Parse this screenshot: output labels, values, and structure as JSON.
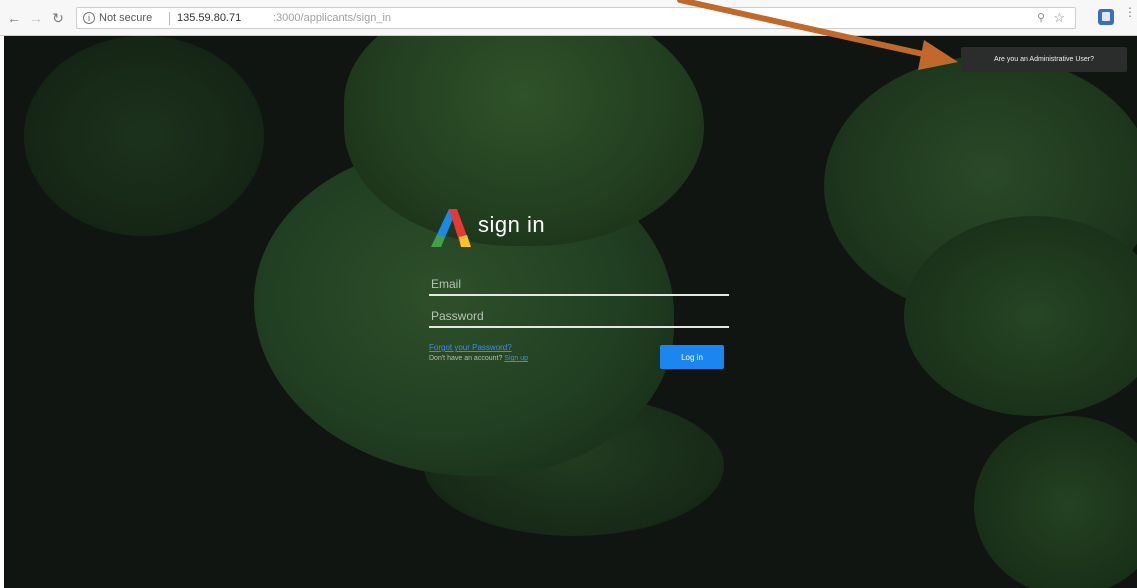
{
  "browser": {
    "back_icon": "back-arrow-icon",
    "forward_icon": "forward-arrow-icon",
    "reload_icon": "reload-icon",
    "security_label": "Not secure",
    "url_host": "135.59.80.71",
    "url_path": ":3000/applicants/sign_in",
    "zoom_icon": "zoom-icon",
    "bookmark_icon": "star-icon",
    "extension_icon": "extension-icon"
  },
  "page": {
    "title": "sign in",
    "logo": "app-logo",
    "email_placeholder": "Email",
    "password_placeholder": "Password",
    "forgot_password_label": "Forgot your Password?",
    "no_account_text": "Don't have an account? ",
    "sign_up_label": "Sign up",
    "login_button_label": "Log in",
    "admin_button_label": "Are you an Administrative User?"
  },
  "colors": {
    "accent": "#1b86f0",
    "admin_button_bg": "#2a2d2b",
    "annotation_arrow": "#c0692c"
  }
}
